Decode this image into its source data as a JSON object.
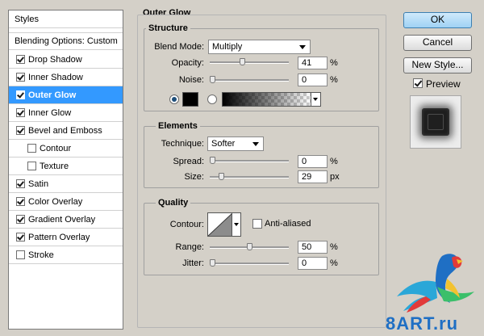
{
  "sidebar": {
    "header": "Styles",
    "blending": "Blending Options: Custom",
    "items": [
      {
        "label": "Drop Shadow",
        "checked": true
      },
      {
        "label": "Inner Shadow",
        "checked": true
      },
      {
        "label": "Outer Glow",
        "checked": true,
        "selected": true
      },
      {
        "label": "Inner Glow",
        "checked": true
      },
      {
        "label": "Bevel and Emboss",
        "checked": true
      },
      {
        "label": "Contour",
        "checked": false,
        "indent": true
      },
      {
        "label": "Texture",
        "checked": false,
        "indent": true
      },
      {
        "label": "Satin",
        "checked": true
      },
      {
        "label": "Color Overlay",
        "checked": true
      },
      {
        "label": "Gradient Overlay",
        "checked": true
      },
      {
        "label": "Pattern Overlay",
        "checked": true
      },
      {
        "label": "Stroke",
        "checked": false
      }
    ]
  },
  "panel": {
    "title": "Outer Glow",
    "structure": {
      "title": "Structure",
      "blend_mode_label": "Blend Mode:",
      "blend_mode_value": "Multiply",
      "opacity_label": "Opacity:",
      "opacity_value": "41",
      "opacity_unit": "%",
      "opacity_level": 0.41,
      "noise_label": "Noise:",
      "noise_value": "0",
      "noise_unit": "%",
      "noise_level": 0,
      "color_swatch": "#000000",
      "color_mode": "solid"
    },
    "elements": {
      "title": "Elements",
      "technique_label": "Technique:",
      "technique_value": "Softer",
      "spread_label": "Spread:",
      "spread_value": "0",
      "spread_unit": "%",
      "spread_level": 0,
      "size_label": "Size:",
      "size_value": "29",
      "size_unit": "px",
      "size_level": 0.12
    },
    "quality": {
      "title": "Quality",
      "contour_label": "Contour:",
      "antialiased_label": "Anti-aliased",
      "antialiased_checked": false,
      "range_label": "Range:",
      "range_value": "50",
      "range_unit": "%",
      "range_level": 0.5,
      "jitter_label": "Jitter:",
      "jitter_value": "0",
      "jitter_unit": "%",
      "jitter_level": 0
    }
  },
  "buttons": {
    "ok": "OK",
    "cancel": "Cancel",
    "new_style": "New Style...",
    "preview_label": "Preview",
    "preview_checked": true
  },
  "watermark": {
    "text": "8ART.ru"
  },
  "colors": {
    "selection": "#3399ff",
    "ok_button": "#a9d7f6"
  }
}
